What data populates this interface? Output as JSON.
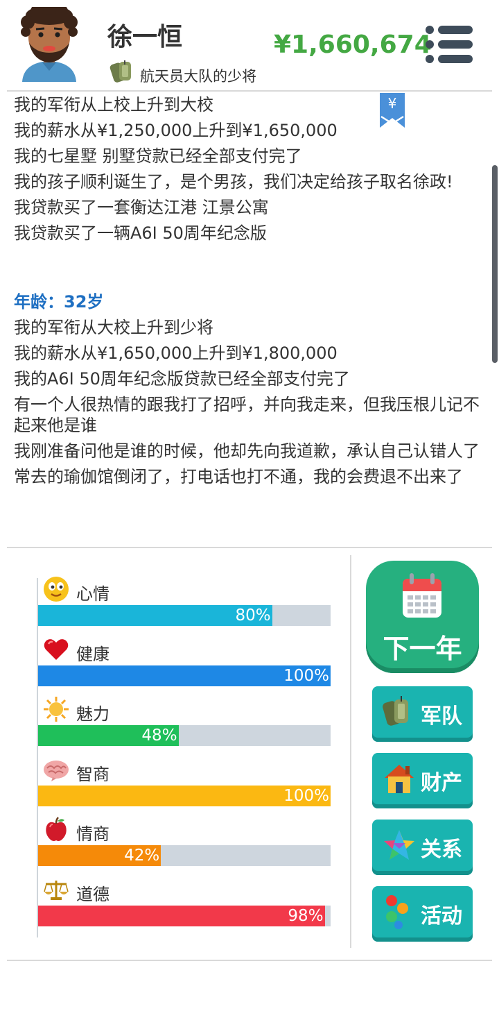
{
  "header": {
    "name": "徐一恒",
    "rank": "航天员大队的少将",
    "money": "¥1,660,674"
  },
  "log": {
    "lines_a": [
      "我的军衔从上校上升到大校",
      "我的薪水从¥1,250,000上升到¥1,650,000",
      "我的七星墅 别墅贷款已经全部支付完了",
      "我的孩子顺利诞生了，是个男孩，我们决定给孩子取名徐政!",
      "我贷款买了一套衡达江港 江景公寓",
      "我贷款买了一辆A6I 50周年纪念版"
    ],
    "age": "年龄：32岁",
    "lines_b": [
      "我的军衔从大校上升到少将",
      "我的薪水从¥1,650,000上升到¥1,800,000",
      "我的A6I 50周年纪念版贷款已经全部支付完了",
      "有一个人很热情的跟我打了招呼，并向我走来，但我压根儿记不起来他是谁",
      "我刚准备问他是谁的时候，他却先向我道歉，承认自己认错人了",
      "常去的瑜伽馆倒闭了，打电话也打不通，我的会费退不出来了"
    ],
    "bookmark_symbol": "¥"
  },
  "stats": [
    {
      "label": "心情",
      "value": 80,
      "text": "80%",
      "color": "#1ab5d9",
      "icon": "smiley-face-icon"
    },
    {
      "label": "健康",
      "value": 100,
      "text": "100%",
      "color": "#1e88e5",
      "icon": "heart-icon"
    },
    {
      "label": "魅力",
      "value": 48,
      "text": "48%",
      "color": "#1fbf5a",
      "icon": "sun-icon"
    },
    {
      "label": "智商",
      "value": 100,
      "text": "100%",
      "color": "#fbb812",
      "icon": "brain-icon"
    },
    {
      "label": "情商",
      "value": 42,
      "text": "42%",
      "color": "#f58a09",
      "icon": "apple-icon"
    },
    {
      "label": "道德",
      "value": 98,
      "text": "98%",
      "color": "#f2394a",
      "icon": "scales-icon"
    }
  ],
  "actions": {
    "next_year": "下一年",
    "buttons": [
      {
        "label": "军队",
        "icon": "military-tag-icon"
      },
      {
        "label": "财产",
        "icon": "house-icon"
      },
      {
        "label": "关系",
        "icon": "star-icon"
      },
      {
        "label": "活动",
        "icon": "activity-dots-icon"
      }
    ]
  },
  "colors": {
    "money": "#44a843",
    "age": "#1e6fc2",
    "next_button": "#26b07f",
    "action_button": "#1ab4b0",
    "bar_track": "#ced6de"
  }
}
